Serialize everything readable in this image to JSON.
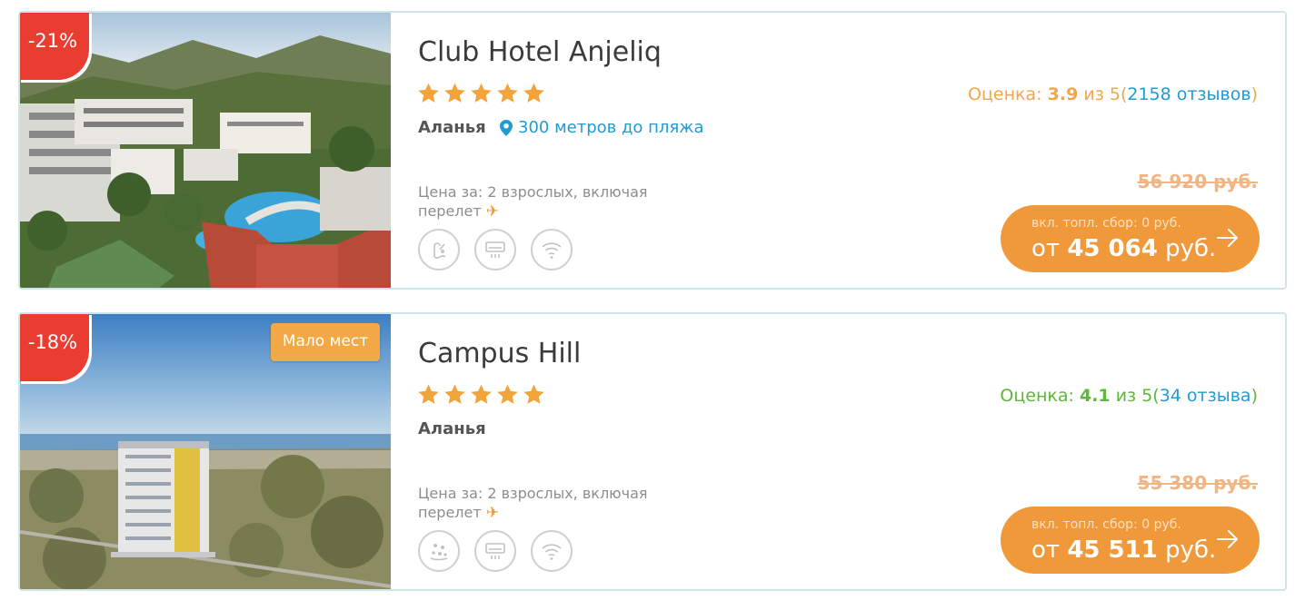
{
  "colors": {
    "accent_orange": "#f0993a",
    "discount_red": "#ea3d32",
    "rating_orange": "#f0a64e",
    "rating_green": "#5cb838",
    "link_blue": "#1f9bd7",
    "star": "#f2a33a"
  },
  "hotels": [
    {
      "discount": "-21%",
      "badge": "",
      "name": "Club Hotel Anjeliq",
      "stars": 5,
      "city": "Аланья",
      "beach": "300 метров до пляжа",
      "price_for": "Цена за: 2 взрослых, включая перелет",
      "amenities": [
        "pool-icon",
        "air-conditioner-icon",
        "wifi-icon"
      ],
      "rating": {
        "label": "Оценка:",
        "score": "3.9",
        "of": "из 5",
        "open": "(",
        "reviews": "2158 отзывов",
        "close": ")"
      },
      "old_price": "56 920 руб.",
      "fee": "вкл. топл. сбор: 0 руб.",
      "price_prefix": "от",
      "price": "45 064",
      "currency": "руб."
    },
    {
      "discount": "-18%",
      "badge": "Мало мест",
      "name": "Campus Hill",
      "stars": 5,
      "city": "Аланья",
      "beach": "",
      "price_for": "Цена за: 2 взрослых, включая перелет",
      "amenities": [
        "kids-club-icon",
        "air-conditioner-icon",
        "wifi-icon"
      ],
      "rating": {
        "label": "Оценка:",
        "score": "4.1",
        "of": "из 5",
        "open": "(",
        "reviews": "34 отзыва",
        "close": ")"
      },
      "old_price": "55 380 руб.",
      "fee": "вкл. топл. сбор: 0 руб.",
      "price_prefix": "от",
      "price": "45 511",
      "currency": "руб."
    }
  ]
}
